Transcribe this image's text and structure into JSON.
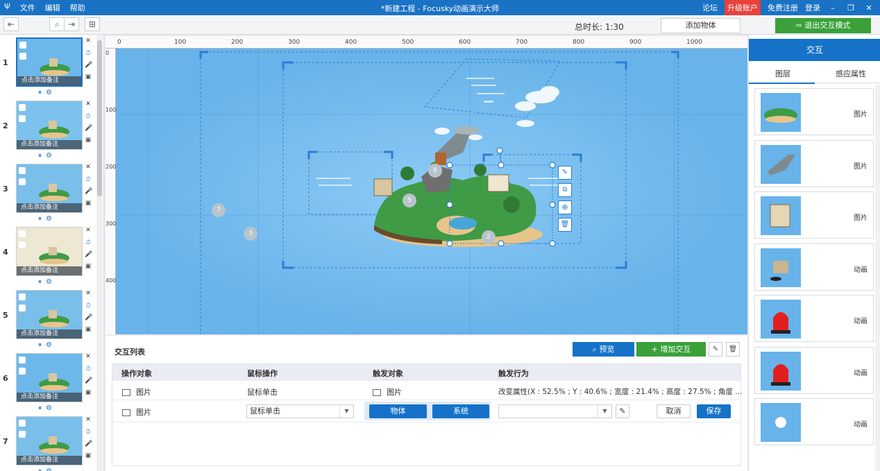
{
  "titlebar": {
    "app_icon": "Ψ",
    "menus": [
      "文件",
      "编辑",
      "帮助"
    ],
    "title": "*新建工程 - Focusky动画演示大师",
    "forum": "论坛",
    "upgrade": "升级账户",
    "register": "免费注册",
    "login": "登录",
    "colors": {
      "bar": "#1a72c4",
      "upgrade": "#e8413c"
    }
  },
  "toolbar": {
    "duration": "总时长: 1:30",
    "add_object": "添加物体",
    "exit_interaction": "退出交互模式",
    "exit_color": "#3aa13a"
  },
  "slides": {
    "note_label": "点击添加备注",
    "items": [
      {
        "number": "1",
        "active": true
      },
      {
        "number": "2",
        "active": false
      },
      {
        "number": "3",
        "active": false
      },
      {
        "number": "4",
        "active": false
      },
      {
        "number": "5",
        "active": false
      },
      {
        "number": "6",
        "active": false
      },
      {
        "number": "7",
        "active": false
      }
    ]
  },
  "ruler": {
    "h_ticks": [
      "0",
      "100",
      "200",
      "300",
      "400",
      "500",
      "600",
      "700",
      "800",
      "900",
      "1000"
    ],
    "v_ticks": [
      "0",
      "100",
      "200",
      "300",
      "400"
    ]
  },
  "canvas": {
    "background": "#67b3ea",
    "markers": [
      "7",
      "3",
      "6",
      "5",
      "2"
    ]
  },
  "interaction_panel": {
    "title": "交互列表",
    "preview": "预览",
    "add_interaction": "增加交互",
    "columns": [
      "操作对象",
      "鼠标操作",
      "触发对象",
      "触发行为"
    ],
    "rows": [
      {
        "object": "图片",
        "mouse": "鼠标单击",
        "trigger_object": "图片",
        "behavior": "改变属性(X : 52.5% ; Y : 40.6% ; 宽度 : 21.4% ; 高度 : 27.5% ; 角度 ..."
      }
    ],
    "edit_row": {
      "object": "图片",
      "mouse_select": "鼠标单击",
      "btn_object": "物体",
      "btn_system": "系统",
      "behavior_select": "",
      "cancel": "取消",
      "save": "保存"
    }
  },
  "right_panel": {
    "header": "交互",
    "tabs": [
      "图层",
      "感应属性"
    ],
    "layers": [
      {
        "type": "图片",
        "icon": "island-thumbnail"
      },
      {
        "type": "图片",
        "icon": "tornado-thumbnail"
      },
      {
        "type": "图片",
        "icon": "building-thumbnail"
      },
      {
        "type": "动画",
        "icon": "machine-thumbnail"
      },
      {
        "type": "动画",
        "icon": "siren-thumbnail"
      },
      {
        "type": "动画",
        "icon": "siren-thumbnail"
      },
      {
        "type": "动画",
        "icon": "fan-thumbnail"
      }
    ]
  }
}
